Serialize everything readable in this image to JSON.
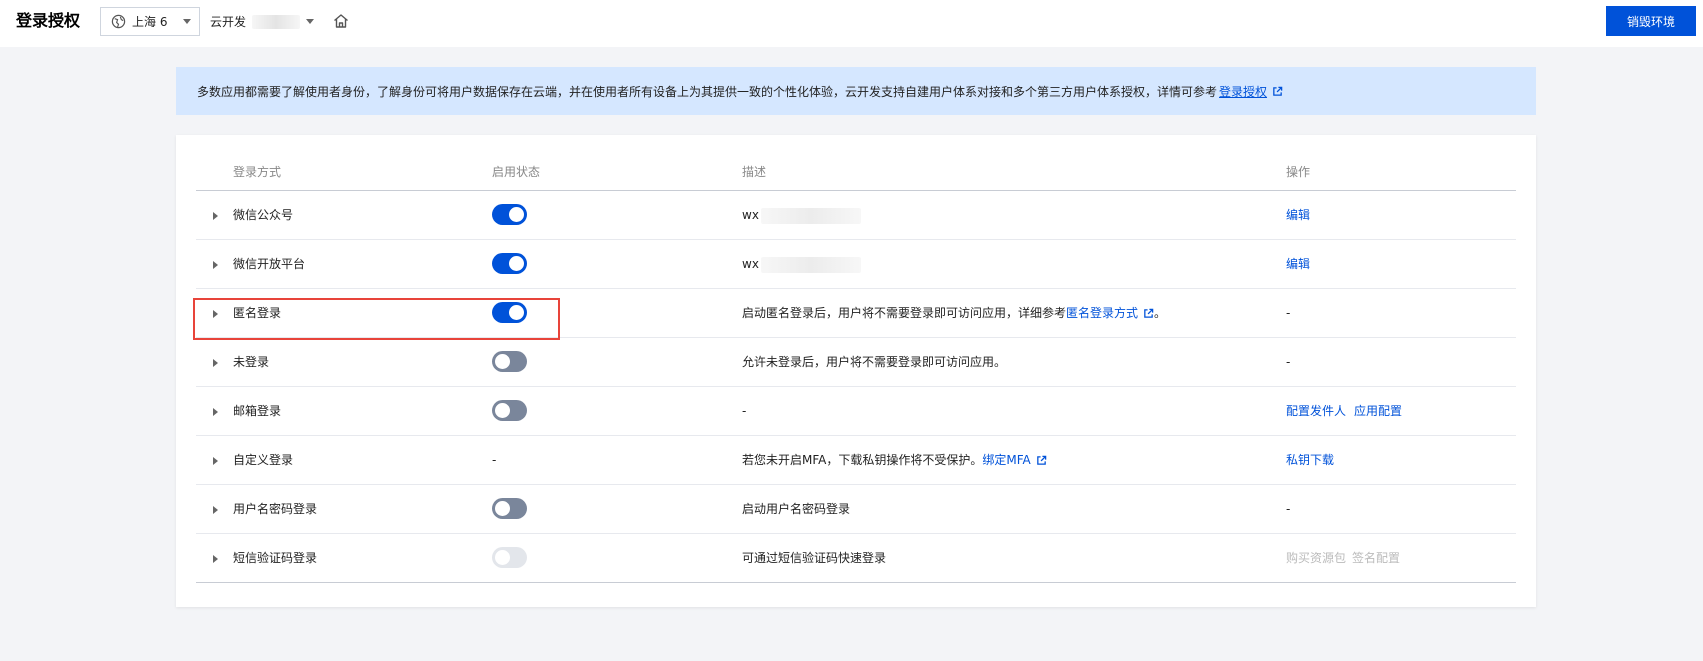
{
  "header": {
    "title": "登录授权",
    "region": "上海 6",
    "env_label": "云开发",
    "destroy_label": "销毁环境"
  },
  "notice": {
    "text": "多数应用都需要了解使用者身份，了解身份可将用户数据保存在云端，并在使用者所有设备上为其提供一致的个性化体验，云开发支持自建用户体系对接和多个第三方用户体系授权，详情可参考",
    "link": "登录授权"
  },
  "table": {
    "columns": [
      "登录方式",
      "启用状态",
      "描述",
      "操作"
    ],
    "rows": [
      {
        "name": "微信公众号",
        "status": "on",
        "desc_prefix": "wx",
        "desc_masked": true,
        "ops": [
          "编辑"
        ]
      },
      {
        "name": "微信开放平台",
        "status": "on",
        "desc_prefix": "wx",
        "desc_masked": true,
        "ops": [
          "编辑"
        ]
      },
      {
        "name": "匿名登录",
        "status": "on",
        "desc": "启动匿名登录后，用户将不需要登录即可访问应用，详细参考",
        "desc_link": "匿名登录方式",
        "desc_suffix": "。",
        "op_text": "-"
      },
      {
        "name": "未登录",
        "status": "off",
        "desc": "允许未登录后，用户将不需要登录即可访问应用。",
        "op_text": "-"
      },
      {
        "name": "邮箱登录",
        "status": "off",
        "desc": "-",
        "ops": [
          "配置发件人",
          "应用配置"
        ]
      },
      {
        "name": "自定义登录",
        "status_text": "-",
        "desc": "若您未开启MFA，下载私钥操作将不受保护。",
        "desc_link": "绑定MFA",
        "ops": [
          "私钥下载"
        ]
      },
      {
        "name": "用户名密码登录",
        "status": "off",
        "desc": "启动用户名密码登录",
        "op_text": "-"
      },
      {
        "name": "短信验证码登录",
        "status": "disabled",
        "desc": "可通过短信验证码快速登录",
        "ops_disabled": [
          "购买资源包",
          "签名配置"
        ]
      }
    ]
  },
  "colors": {
    "accent": "#0052d9",
    "notice_bg": "#d5e7ff",
    "highlight": "#e8443a",
    "toggle_off": "#7a869b"
  }
}
